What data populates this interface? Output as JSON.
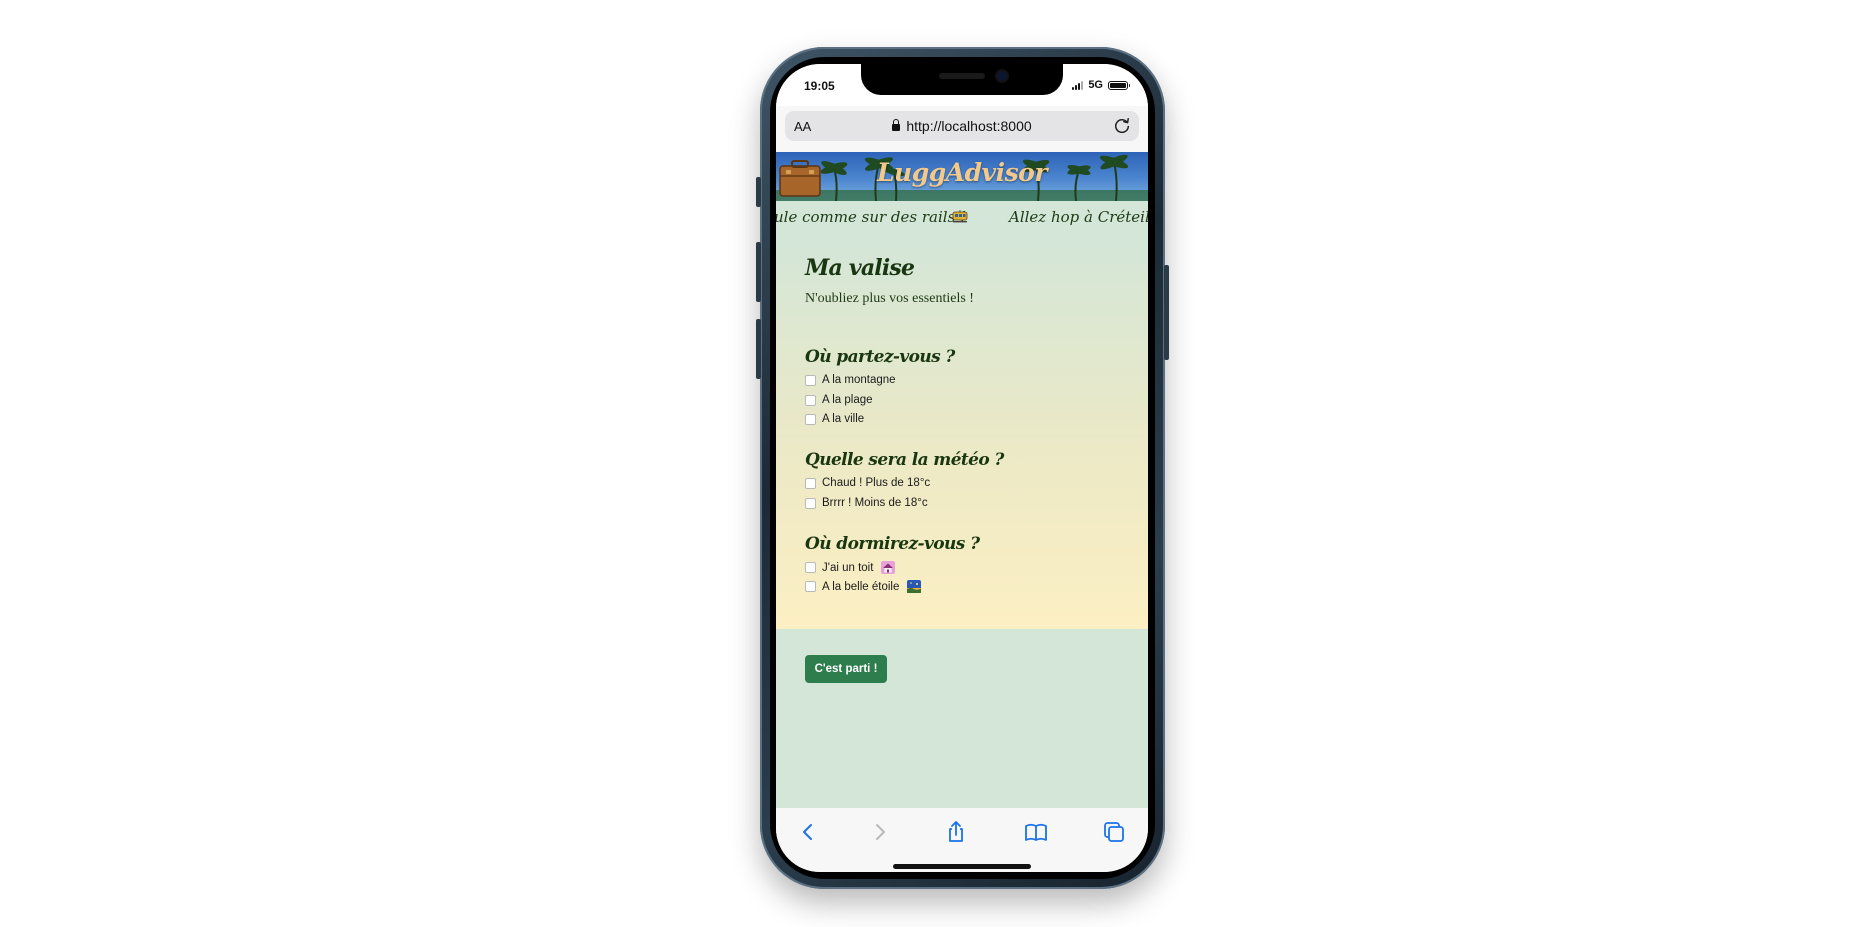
{
  "status_bar": {
    "time": "19:05",
    "network": "5G"
  },
  "browser": {
    "text_size_label": "AA",
    "url": "http://localhost:8000"
  },
  "site": {
    "brand": "LuggAdvisor",
    "ticker": {
      "left_text": "ule comme sur des rails !",
      "right_text": "Allez hop à Créteil !"
    }
  },
  "form": {
    "title": "Ma valise",
    "subtitle": "N'oubliez plus vos essentiels !",
    "sections": [
      {
        "heading": "Où partez-vous ?",
        "options": [
          "A la montagne",
          "A la plage",
          "A la ville"
        ]
      },
      {
        "heading": "Quelle sera la météo ?",
        "options": [
          "Chaud ! Plus de 18°c",
          "Brrrr ! Moins de 18°c"
        ]
      },
      {
        "heading": "Où dormirez-vous ?",
        "options": [
          "J'ai un toit",
          "A la belle étoile"
        ]
      }
    ],
    "submit_label": "C'est parti !"
  },
  "colors": {
    "heading_green": "#18360f",
    "button_green": "#2e7d4d",
    "brand_text": "#f3c98b",
    "toolbar_blue": "#1a73e8"
  },
  "icons": {
    "ticker": "tram-icon",
    "sleep_roof": "house-emoji-icon",
    "sleep_stars": "night-sky-emoji-icon"
  }
}
